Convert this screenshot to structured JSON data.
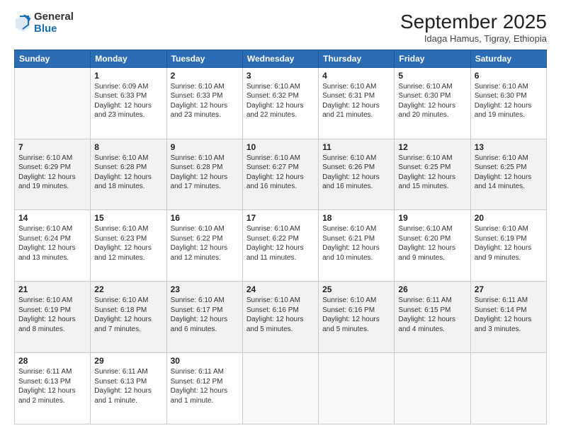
{
  "logo": {
    "general": "General",
    "blue": "Blue"
  },
  "header": {
    "month": "September 2025",
    "location": "Idaga Hamus, Tigray, Ethiopia"
  },
  "days_of_week": [
    "Sunday",
    "Monday",
    "Tuesday",
    "Wednesday",
    "Thursday",
    "Friday",
    "Saturday"
  ],
  "weeks": [
    [
      {
        "day": "",
        "info": ""
      },
      {
        "day": "1",
        "info": "Sunrise: 6:09 AM\nSunset: 6:33 PM\nDaylight: 12 hours\nand 23 minutes."
      },
      {
        "day": "2",
        "info": "Sunrise: 6:10 AM\nSunset: 6:33 PM\nDaylight: 12 hours\nand 23 minutes."
      },
      {
        "day": "3",
        "info": "Sunrise: 6:10 AM\nSunset: 6:32 PM\nDaylight: 12 hours\nand 22 minutes."
      },
      {
        "day": "4",
        "info": "Sunrise: 6:10 AM\nSunset: 6:31 PM\nDaylight: 12 hours\nand 21 minutes."
      },
      {
        "day": "5",
        "info": "Sunrise: 6:10 AM\nSunset: 6:30 PM\nDaylight: 12 hours\nand 20 minutes."
      },
      {
        "day": "6",
        "info": "Sunrise: 6:10 AM\nSunset: 6:30 PM\nDaylight: 12 hours\nand 19 minutes."
      }
    ],
    [
      {
        "day": "7",
        "info": "Sunrise: 6:10 AM\nSunset: 6:29 PM\nDaylight: 12 hours\nand 19 minutes."
      },
      {
        "day": "8",
        "info": "Sunrise: 6:10 AM\nSunset: 6:28 PM\nDaylight: 12 hours\nand 18 minutes."
      },
      {
        "day": "9",
        "info": "Sunrise: 6:10 AM\nSunset: 6:28 PM\nDaylight: 12 hours\nand 17 minutes."
      },
      {
        "day": "10",
        "info": "Sunrise: 6:10 AM\nSunset: 6:27 PM\nDaylight: 12 hours\nand 16 minutes."
      },
      {
        "day": "11",
        "info": "Sunrise: 6:10 AM\nSunset: 6:26 PM\nDaylight: 12 hours\nand 16 minutes."
      },
      {
        "day": "12",
        "info": "Sunrise: 6:10 AM\nSunset: 6:25 PM\nDaylight: 12 hours\nand 15 minutes."
      },
      {
        "day": "13",
        "info": "Sunrise: 6:10 AM\nSunset: 6:25 PM\nDaylight: 12 hours\nand 14 minutes."
      }
    ],
    [
      {
        "day": "14",
        "info": "Sunrise: 6:10 AM\nSunset: 6:24 PM\nDaylight: 12 hours\nand 13 minutes."
      },
      {
        "day": "15",
        "info": "Sunrise: 6:10 AM\nSunset: 6:23 PM\nDaylight: 12 hours\nand 12 minutes."
      },
      {
        "day": "16",
        "info": "Sunrise: 6:10 AM\nSunset: 6:22 PM\nDaylight: 12 hours\nand 12 minutes."
      },
      {
        "day": "17",
        "info": "Sunrise: 6:10 AM\nSunset: 6:22 PM\nDaylight: 12 hours\nand 11 minutes."
      },
      {
        "day": "18",
        "info": "Sunrise: 6:10 AM\nSunset: 6:21 PM\nDaylight: 12 hours\nand 10 minutes."
      },
      {
        "day": "19",
        "info": "Sunrise: 6:10 AM\nSunset: 6:20 PM\nDaylight: 12 hours\nand 9 minutes."
      },
      {
        "day": "20",
        "info": "Sunrise: 6:10 AM\nSunset: 6:19 PM\nDaylight: 12 hours\nand 9 minutes."
      }
    ],
    [
      {
        "day": "21",
        "info": "Sunrise: 6:10 AM\nSunset: 6:19 PM\nDaylight: 12 hours\nand 8 minutes."
      },
      {
        "day": "22",
        "info": "Sunrise: 6:10 AM\nSunset: 6:18 PM\nDaylight: 12 hours\nand 7 minutes."
      },
      {
        "day": "23",
        "info": "Sunrise: 6:10 AM\nSunset: 6:17 PM\nDaylight: 12 hours\nand 6 minutes."
      },
      {
        "day": "24",
        "info": "Sunrise: 6:10 AM\nSunset: 6:16 PM\nDaylight: 12 hours\nand 5 minutes."
      },
      {
        "day": "25",
        "info": "Sunrise: 6:10 AM\nSunset: 6:16 PM\nDaylight: 12 hours\nand 5 minutes."
      },
      {
        "day": "26",
        "info": "Sunrise: 6:11 AM\nSunset: 6:15 PM\nDaylight: 12 hours\nand 4 minutes."
      },
      {
        "day": "27",
        "info": "Sunrise: 6:11 AM\nSunset: 6:14 PM\nDaylight: 12 hours\nand 3 minutes."
      }
    ],
    [
      {
        "day": "28",
        "info": "Sunrise: 6:11 AM\nSunset: 6:13 PM\nDaylight: 12 hours\nand 2 minutes."
      },
      {
        "day": "29",
        "info": "Sunrise: 6:11 AM\nSunset: 6:13 PM\nDaylight: 12 hours\nand 1 minute."
      },
      {
        "day": "30",
        "info": "Sunrise: 6:11 AM\nSunset: 6:12 PM\nDaylight: 12 hours\nand 1 minute."
      },
      {
        "day": "",
        "info": ""
      },
      {
        "day": "",
        "info": ""
      },
      {
        "day": "",
        "info": ""
      },
      {
        "day": "",
        "info": ""
      }
    ]
  ]
}
